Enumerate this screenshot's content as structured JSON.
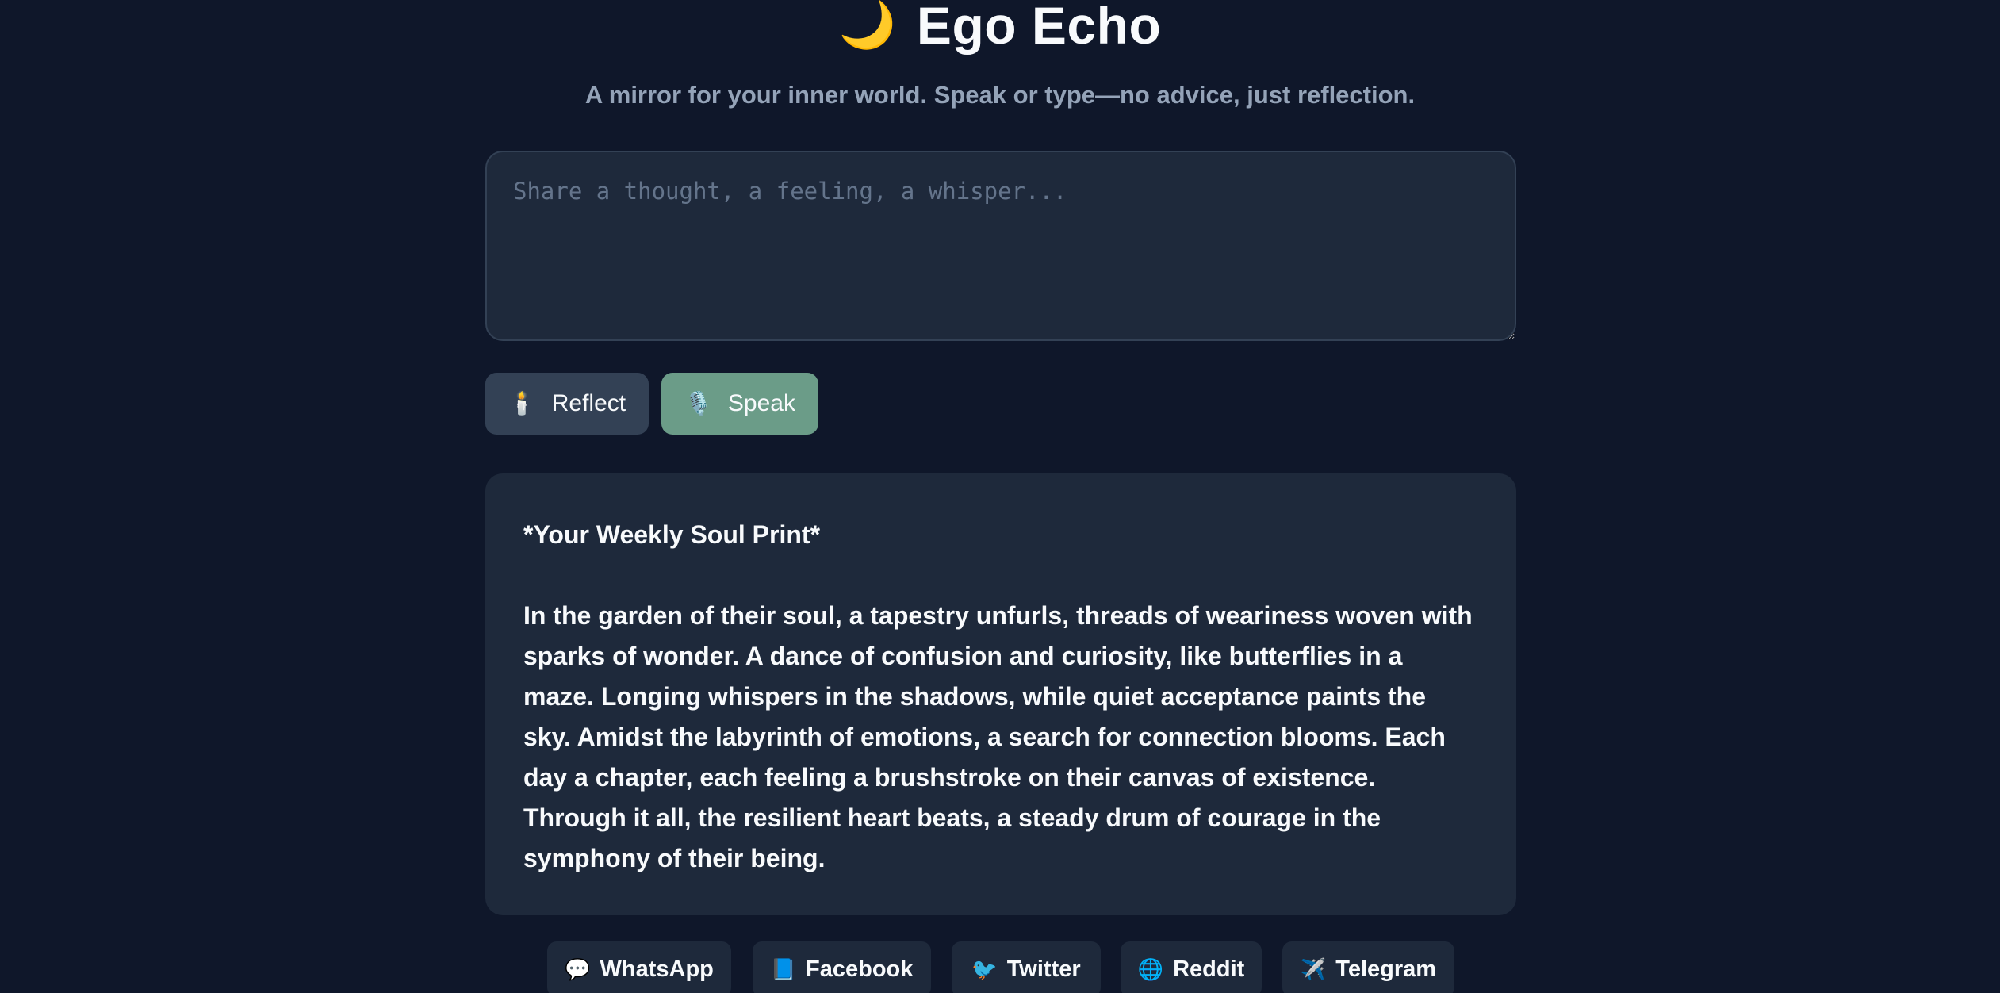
{
  "header": {
    "title_icon": "moon-icon",
    "title_icon_glyph": "🌙",
    "title": "Ego Echo",
    "subtitle": "A mirror for your inner world. Speak or type—no advice, just reflection."
  },
  "input": {
    "value": "",
    "placeholder": "Share a thought, a feeling, a whisper..."
  },
  "actions": {
    "reflect": {
      "icon": "candle-icon",
      "glyph": "🕯️",
      "label": "Reflect"
    },
    "speak": {
      "icon": "microphone-icon",
      "glyph": "🎙️",
      "label": "Speak"
    }
  },
  "reflection": {
    "heading": "*Your Weekly Soul Print*",
    "body": "In the garden of their soul, a tapestry unfurls, threads of weariness woven with sparks of wonder. A dance of confusion and curiosity, like butterflies in a maze. Longing whispers in the shadows, while quiet acceptance paints the sky. Amidst the labyrinth of emotions, a search for connection blooms. Each day a chapter, each feeling a brushstroke on their canvas of existence. Through it all, the resilient heart beats, a steady drum of courage in the symphony of their being."
  },
  "share": [
    {
      "icon": "speech-bubble-icon",
      "glyph": "💬",
      "label": "WhatsApp"
    },
    {
      "icon": "blue-book-icon",
      "glyph": "📘",
      "label": "Facebook"
    },
    {
      "icon": "bird-icon",
      "glyph": "🐦",
      "label": "Twitter"
    },
    {
      "icon": "globe-icon",
      "glyph": "🌐",
      "label": "Reddit"
    },
    {
      "icon": "airplane-icon",
      "glyph": "✈️",
      "label": "Telegram"
    }
  ],
  "colors": {
    "background": "#0f172a",
    "card": "#1e293b",
    "reflect_button": "#334155",
    "speak_button": "#6b9c88",
    "subtitle": "#94a3b8"
  }
}
